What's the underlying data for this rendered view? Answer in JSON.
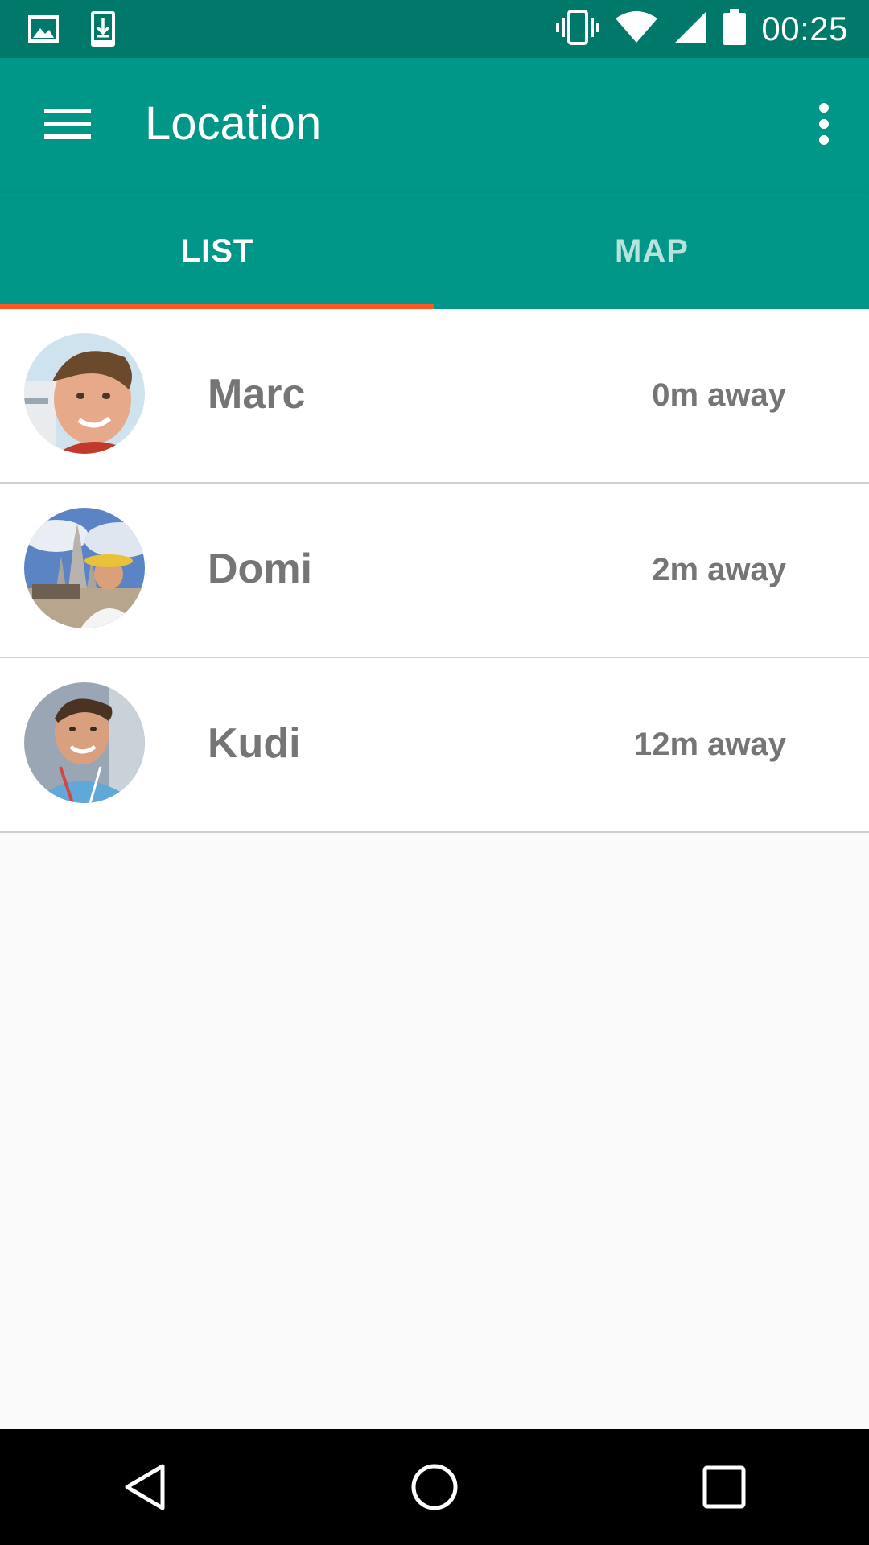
{
  "status_bar": {
    "time": "00:25",
    "icons": [
      "image-icon",
      "download-icon",
      "vibrate-icon",
      "wifi-icon",
      "signal-icon",
      "battery-icon"
    ]
  },
  "toolbar": {
    "title": "Location",
    "menu_icon": "hamburger-menu-icon",
    "overflow_icon": "more-vert-icon"
  },
  "tabs": [
    {
      "label": "LIST",
      "selected": true
    },
    {
      "label": "MAP",
      "selected": false
    }
  ],
  "people": [
    {
      "name": "Marc",
      "distance": "0m away"
    },
    {
      "name": "Domi",
      "distance": "2m away"
    },
    {
      "name": "Kudi",
      "distance": "12m away"
    }
  ],
  "nav_bar": {
    "icons": [
      "back-icon",
      "home-icon",
      "recents-icon"
    ]
  },
  "colors": {
    "status_bar": "#00796b",
    "primary": "#009688",
    "tab_indicator": "#ff5722",
    "text_secondary": "#757575",
    "background": "#fafafa"
  }
}
